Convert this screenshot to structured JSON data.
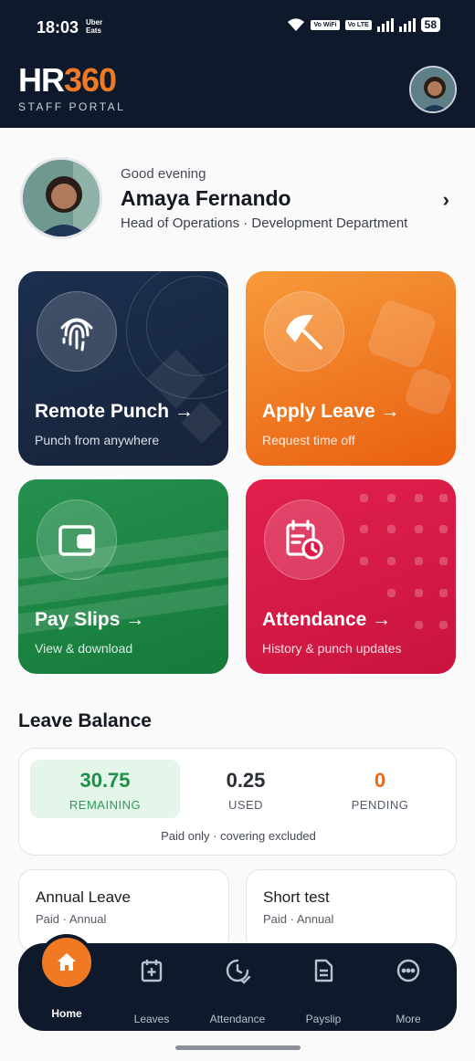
{
  "status_bar": {
    "time": "18:03",
    "app_badge": "Uber Eats",
    "wifi_tag": "Vo WiFi",
    "lte_tag": "Vo LTE",
    "battery": "58"
  },
  "header": {
    "logo_main": "HR",
    "logo_num": "360",
    "subtitle": "STAFF PORTAL"
  },
  "profile": {
    "greeting": "Good evening",
    "name": "Amaya Fernando",
    "role": "Head of Operations · Development Department"
  },
  "tiles": [
    {
      "title": "Remote Punch →",
      "subtitle": "Punch from anywhere",
      "icon": "fingerprint-icon",
      "color": "#17243a"
    },
    {
      "title": "Apply Leave →",
      "subtitle": "Request time off",
      "icon": "umbrella-icon",
      "color": "#f07a24"
    },
    {
      "title": "Pay Slips →",
      "subtitle": "View & download",
      "icon": "wallet-icon",
      "color": "#1f8a48"
    },
    {
      "title": "Attendance →",
      "subtitle": "History & punch updates",
      "icon": "calendar-clock-icon",
      "color": "#d81b48"
    }
  ],
  "leave_balance": {
    "title": "Leave Balance",
    "remaining_value": "30.75",
    "remaining_label": "REMAINING",
    "used_value": "0.25",
    "used_label": "USED",
    "pending_value": "0",
    "pending_label": "PENDING",
    "note": "Paid only · covering excluded"
  },
  "leave_types": [
    {
      "name": "Annual Leave",
      "meta": "Paid · Annual"
    },
    {
      "name": "Short test",
      "meta": "Paid · Annual"
    }
  ],
  "nav": {
    "home": "Home",
    "leaves": "Leaves",
    "attendance": "Attendance",
    "payslip": "Payslip",
    "more": "More"
  },
  "colors": {
    "navy": "#0e1a2b",
    "accent": "#f07a24",
    "green": "#1f8f47",
    "pending": "#ea6a17"
  }
}
